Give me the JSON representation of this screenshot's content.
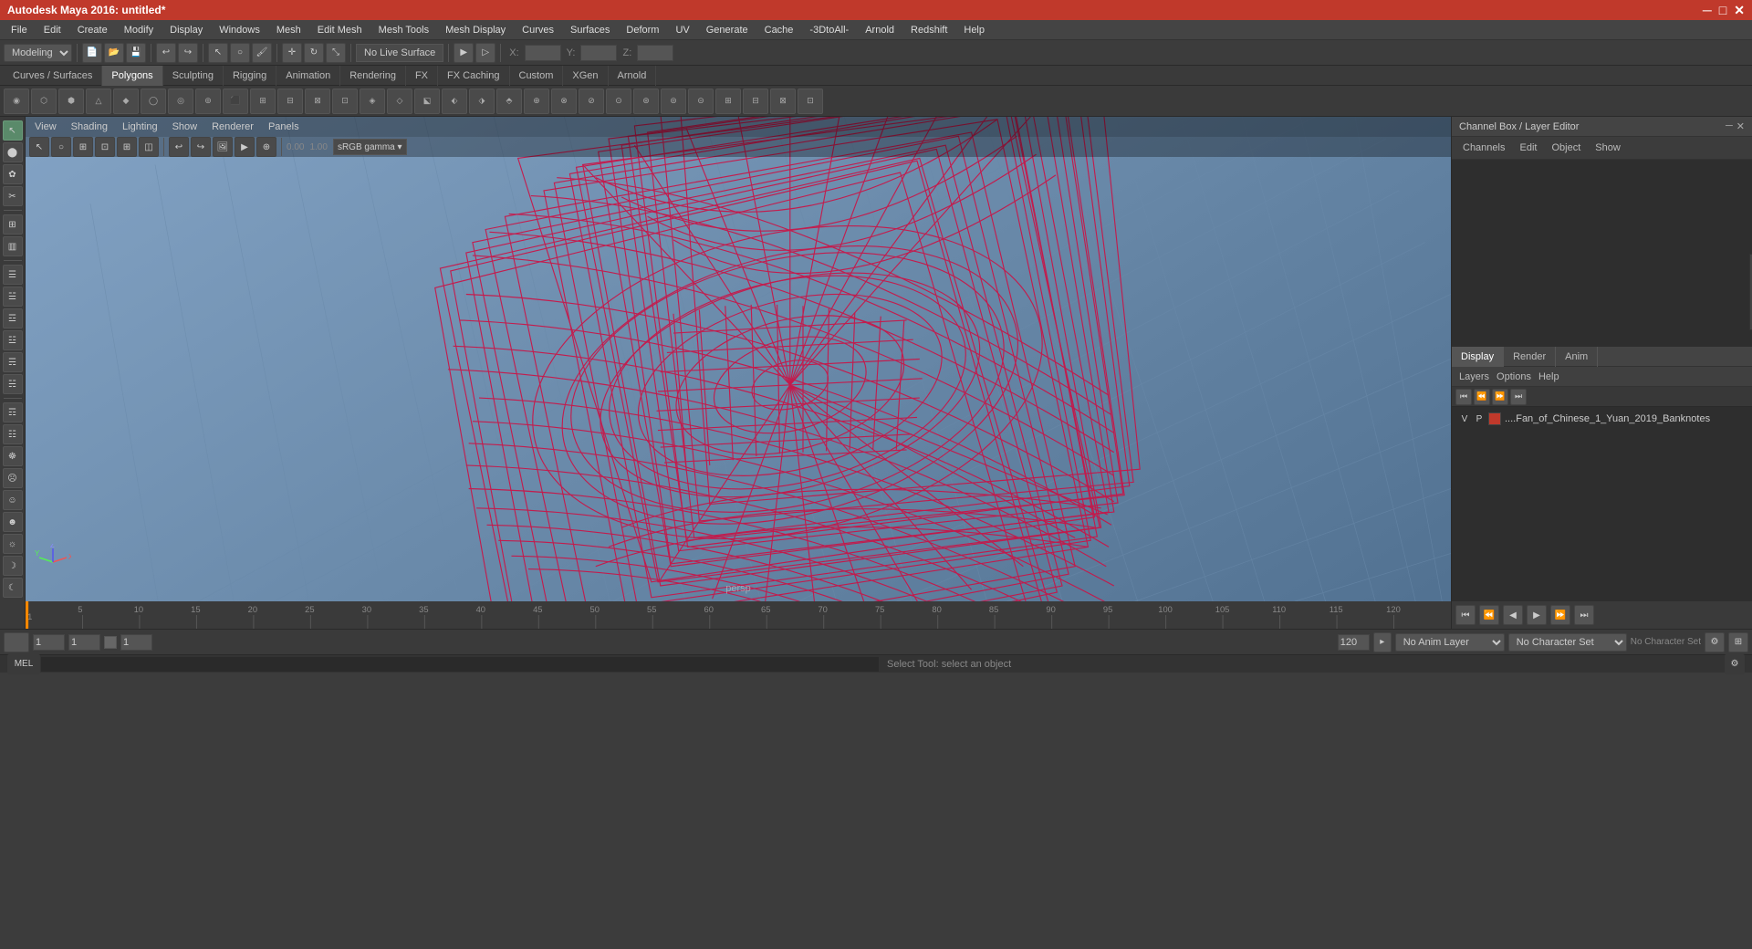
{
  "titlebar": {
    "title": "Autodesk Maya 2016: untitled*",
    "minimize": "─",
    "maximize": "□",
    "close": "✕"
  },
  "menubar": {
    "items": [
      "File",
      "Edit",
      "Create",
      "Modify",
      "Display",
      "Windows",
      "Mesh",
      "Edit Mesh",
      "Mesh Tools",
      "Mesh Display",
      "Curves",
      "Surfaces",
      "Deform",
      "UV",
      "Generate",
      "Cache",
      "-3DtoAll-",
      "Arnold",
      "Redshift",
      "Help"
    ]
  },
  "toolbar1": {
    "dropdown": "Modeling",
    "no_live_surface": "No Live Surface"
  },
  "shelf": {
    "tabs": [
      "Curves / Surfaces",
      "Polygons",
      "Sculpting",
      "Rigging",
      "Animation",
      "Rendering",
      "FX",
      "FX Caching",
      "Custom",
      "XGen",
      "Arnold"
    ],
    "active_tab": "Polygons"
  },
  "viewport": {
    "menus": [
      "View",
      "Shading",
      "Lighting",
      "Show",
      "Renderer",
      "Panels"
    ],
    "label": "persp",
    "gamma": "sRGB gamma",
    "value1": "0.00",
    "value2": "1.00"
  },
  "channel_box": {
    "title": "Channel Box / Layer Editor",
    "tabs": [
      "Channels",
      "Edit",
      "Object",
      "Show"
    ]
  },
  "panel_tabs": {
    "items": [
      "Display",
      "Render",
      "Anim"
    ],
    "active": "Display"
  },
  "layers": {
    "tabs": [
      "Layers",
      "Options",
      "Help"
    ],
    "items": [
      {
        "v": "V",
        "p": "P",
        "color": "#c0392b",
        "name": "....Fan_of_Chinese_1_Yuan_2019_Banknotes"
      }
    ]
  },
  "timeline": {
    "start": 1,
    "end": 120,
    "current": 1,
    "ticks": [
      "1",
      "5",
      "10",
      "15",
      "20",
      "25",
      "30",
      "35",
      "40",
      "45",
      "50",
      "55",
      "60",
      "65",
      "70",
      "75",
      "80",
      "85",
      "90",
      "95",
      "100",
      "105",
      "110",
      "115",
      "120"
    ]
  },
  "bottom": {
    "frame_start": "1",
    "frame_current": "1",
    "frame_display": "1",
    "frame_end": "120",
    "anim_layer": "No Anim Layer",
    "char_set": "No Character Set"
  },
  "statusbar": {
    "text": "Select Tool: select an object",
    "mode": "MEL"
  },
  "coordinates": {
    "x_label": "X:",
    "y_label": "Y:",
    "z_label": "Z:"
  }
}
